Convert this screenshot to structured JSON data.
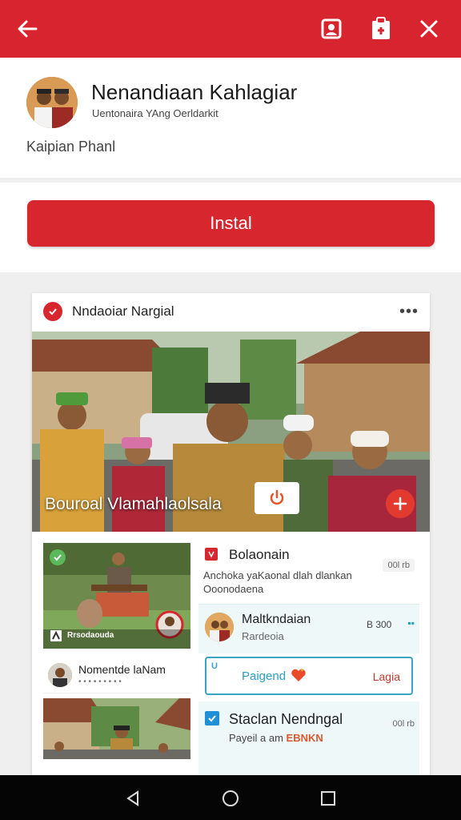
{
  "topbar": {
    "back_icon": "arrow-left-icon",
    "actions": [
      "profile-icon",
      "clipboard-icon",
      "close-icon"
    ]
  },
  "app": {
    "title": "Nenandiaan Kahlagiar",
    "subtitle": "Uentonaira YAng Oerldarkit",
    "developer": "Kaipian Phanl"
  },
  "install_label": "Instal",
  "card": {
    "title": "Nndaoiar Nargial",
    "more": "•••",
    "hero_caption": "Bouroal Vlamahlaolsala",
    "thumb_label": "Rrsodaouda",
    "person": {
      "name": "Nomentde laNam",
      "sub": "• • • • • • • • •"
    },
    "item1": {
      "title": "Bolaonain",
      "desc": "Anchoka yaKaonal dlah dlankan Ooonodaena",
      "badge": "00l rb"
    },
    "item2": {
      "name": "Maltkndaian",
      "sub": "Rardeoia",
      "price": "B 300",
      "arrow": "▪▪"
    },
    "item3": {
      "tag": "U",
      "label": "Paigend",
      "right": "Lagia"
    },
    "item4": {
      "title": "Staclan Nendngal",
      "sub_prefix": "Payeil a am",
      "sub_highlight": "EBNKN",
      "badge": "00l rb"
    }
  },
  "colors": {
    "brand_red": "#d8242e",
    "accent_teal": "#35a6c8"
  }
}
